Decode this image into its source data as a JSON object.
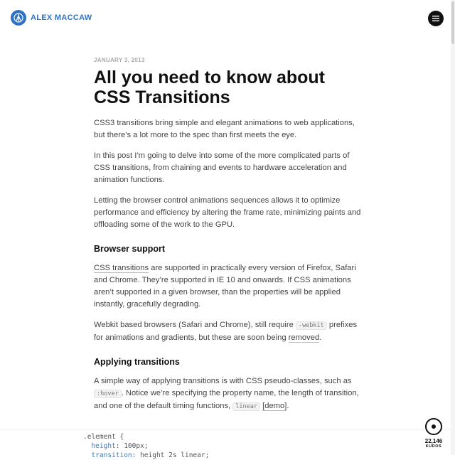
{
  "header": {
    "site_name": "ALEX MACCAW",
    "logo_icon": "blog-logo-icon",
    "menu_icon": "hamburger-menu-icon",
    "colors": {
      "brand": "#2f72c4",
      "menu_button": "#111111"
    }
  },
  "article": {
    "date": "JANUARY 3, 2013",
    "title": "All you need to know about CSS Transitions",
    "intro_paragraph": "CSS3 transitions bring simple and elegant animations to web applications, but there’s a lot more to the spec than first meets the eye.",
    "paragraph_2": "In this post I’m going to delve into some of the more complicated parts of CSS transitions, from chaining and events to hardware acceleration and animation functions.",
    "paragraph_3": "Letting the browser control animations sequences allows it to optimize performance and efficiency by altering the frame rate, minimizing paints and offloading some of the work to the GPU.",
    "section_browser_support": {
      "heading": "Browser support",
      "p1_link": "CSS transitions",
      "p1_rest": " are supported in practically every version of Firefox, Safari and Chrome. They’re supported in IE 10 and onwards. If CSS animations aren’t supported in a given browser, than the properties will be applied instantly, gracefully degrading.",
      "p2_start": "Webkit based browsers (Safari and Chrome), still require ",
      "p2_code": "-webkit",
      "p2_mid": " prefixes for animations and gradients, but these are soon being ",
      "p2_link": "removed",
      "p2_end": "."
    },
    "section_applying": {
      "heading": "Applying transitions",
      "p1_start": "A simple way of applying transitions is with CSS pseudo-classes, such as ",
      "p1_code1": ":hover",
      "p1_mid": ". Notice we’re specifying the property name, the length of transition, and one of the default timing functions, ",
      "p1_code2": "linear",
      "p1_space": " ",
      "p1_link": "[demo]",
      "p1_end": "."
    }
  },
  "code_block": {
    "line1": ".element {",
    "line2_prop": "  height",
    "line2_val": ": 100px;",
    "line3_prop": "  transition",
    "line3_val": ": height 2s linear;"
  },
  "kudos": {
    "count": "22,146",
    "label": "KUDOS",
    "icon": "kudos-circle-icon"
  }
}
